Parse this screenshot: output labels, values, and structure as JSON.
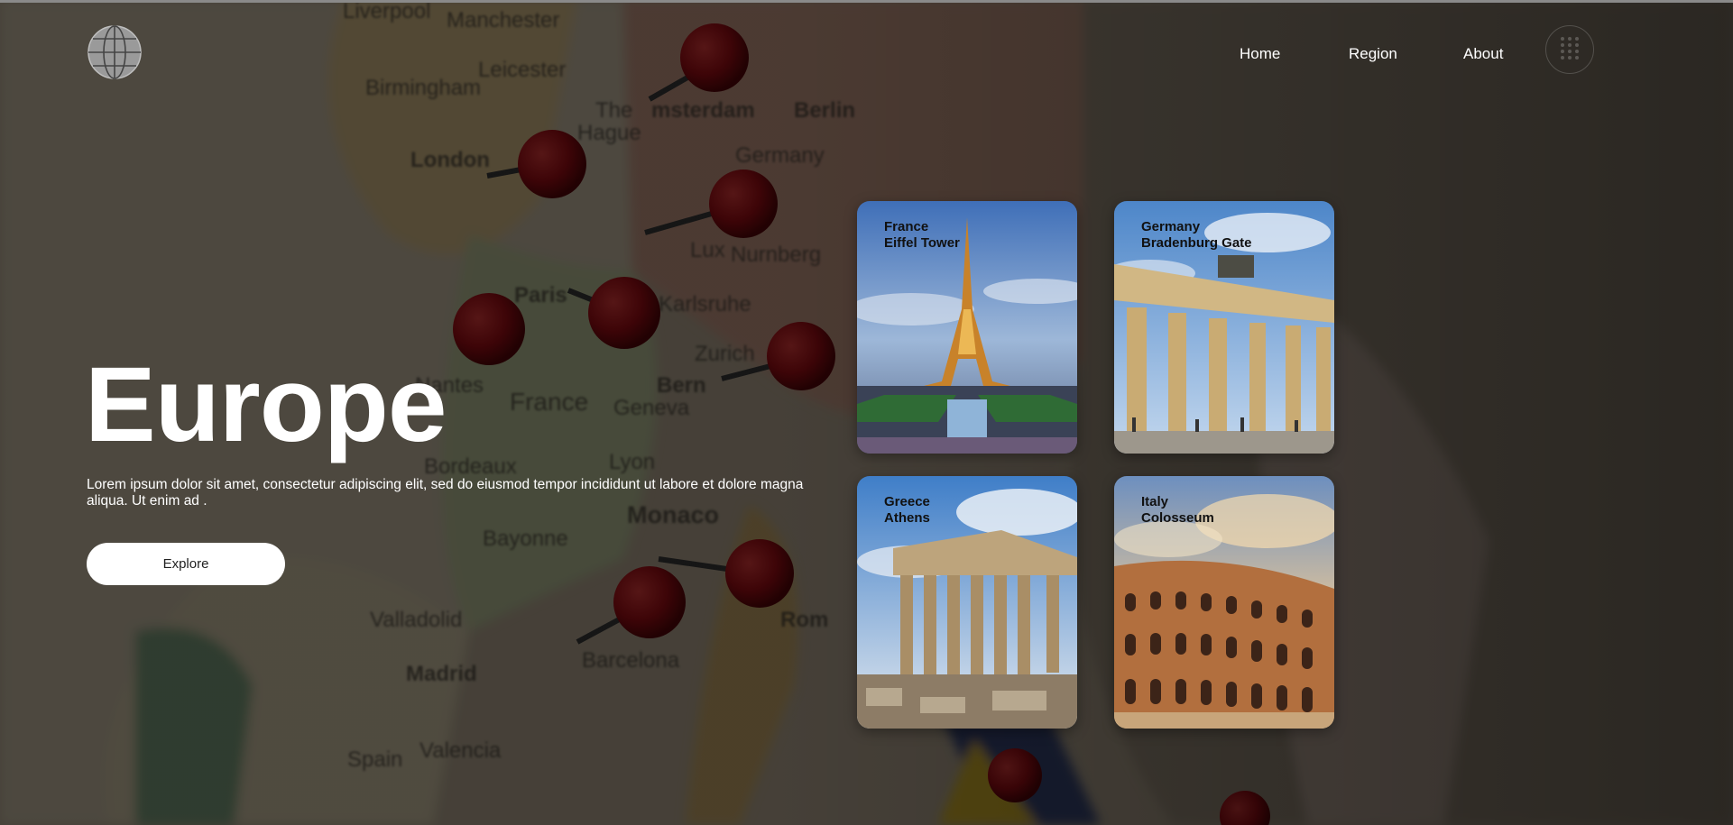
{
  "nav": {
    "items": [
      "Home",
      "Region",
      "About"
    ]
  },
  "hero": {
    "title": "Europe",
    "description": "Lorem ipsum dolor sit amet, consectetur adipiscing elit, sed do eiusmod tempor incididunt ut labore et dolore magna aliqua. Ut enim ad .",
    "button_label": "Explore"
  },
  "background_map_labels": [
    "Liverpool",
    "Manchester",
    "Leicester",
    "Birmingham",
    "London",
    "The Hague",
    "Amsterdam",
    "Germany",
    "Berlin",
    "Paris",
    "France",
    "Bern",
    "Geneva",
    "Zurich",
    "Karlsruhe",
    "Nantes",
    "Bordeaux",
    "Lyon",
    "Monaco",
    "Bayonne",
    "Valladolid",
    "Madrid",
    "Barcelona",
    "Spain",
    "Valencia",
    "Rome",
    "Lux",
    "Nurnberg"
  ],
  "cards": [
    {
      "country": "France",
      "landmark": "Eiffel Tower"
    },
    {
      "country": "Germany",
      "landmark": "Bradenburg Gate"
    },
    {
      "country": "Greece",
      "landmark": "Athens"
    },
    {
      "country": "Italy",
      "landmark": "Colosseum"
    }
  ],
  "colors": {
    "overlay": "#000000",
    "pin": "#b3101a",
    "button_bg": "#ffffff"
  },
  "icons": [
    "globe-icon",
    "grid-menu-icon"
  ]
}
